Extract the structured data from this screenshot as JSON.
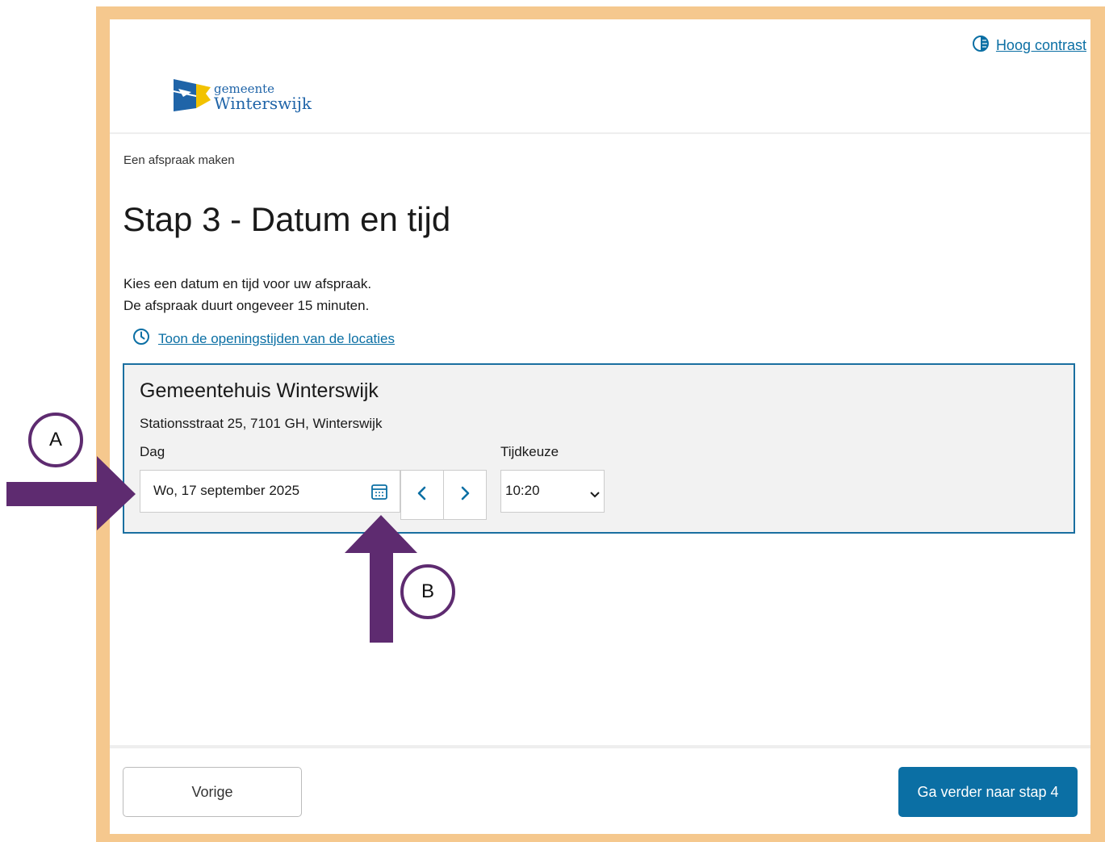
{
  "header": {
    "contrast_link": "Hoog contrast",
    "logo": {
      "line1": "gemeente",
      "line2": "Winterswijk"
    }
  },
  "breadcrumb": "Een afspraak maken",
  "title": "Stap 3 - Datum en tijd",
  "intro": {
    "line1": "Kies een datum en tijd voor uw afspraak.",
    "line2": "De afspraak duurt ongeveer 15 minuten."
  },
  "hours_link": "Toon de openingstijden van de locaties",
  "location": {
    "name": "Gemeentehuis Winterswijk",
    "address": "Stationsstraat 25, 7101 GH, Winterswijk",
    "day_label": "Dag",
    "day_value": "Wo, 17 september 2025",
    "time_label": "Tijdkeuze",
    "time_value": "10:20"
  },
  "footer": {
    "prev_label": "Vorige",
    "next_label": "Ga verder naar stap 4"
  },
  "annotations": {
    "a_label": "A",
    "b_label": "B"
  },
  "icons": {
    "contrast": "contrast-icon",
    "clock": "clock-icon",
    "calendar": "calendar-icon",
    "prev_day": "chevron-left-icon",
    "next_day": "chevron-right-icon",
    "select": "chevron-down-icon"
  },
  "colors": {
    "frame": "#f5c88e",
    "link": "#0b6fa4",
    "primary_button": "#0b6fa4",
    "location_border": "#1a6fa0",
    "annotation": "#5e2b70"
  }
}
